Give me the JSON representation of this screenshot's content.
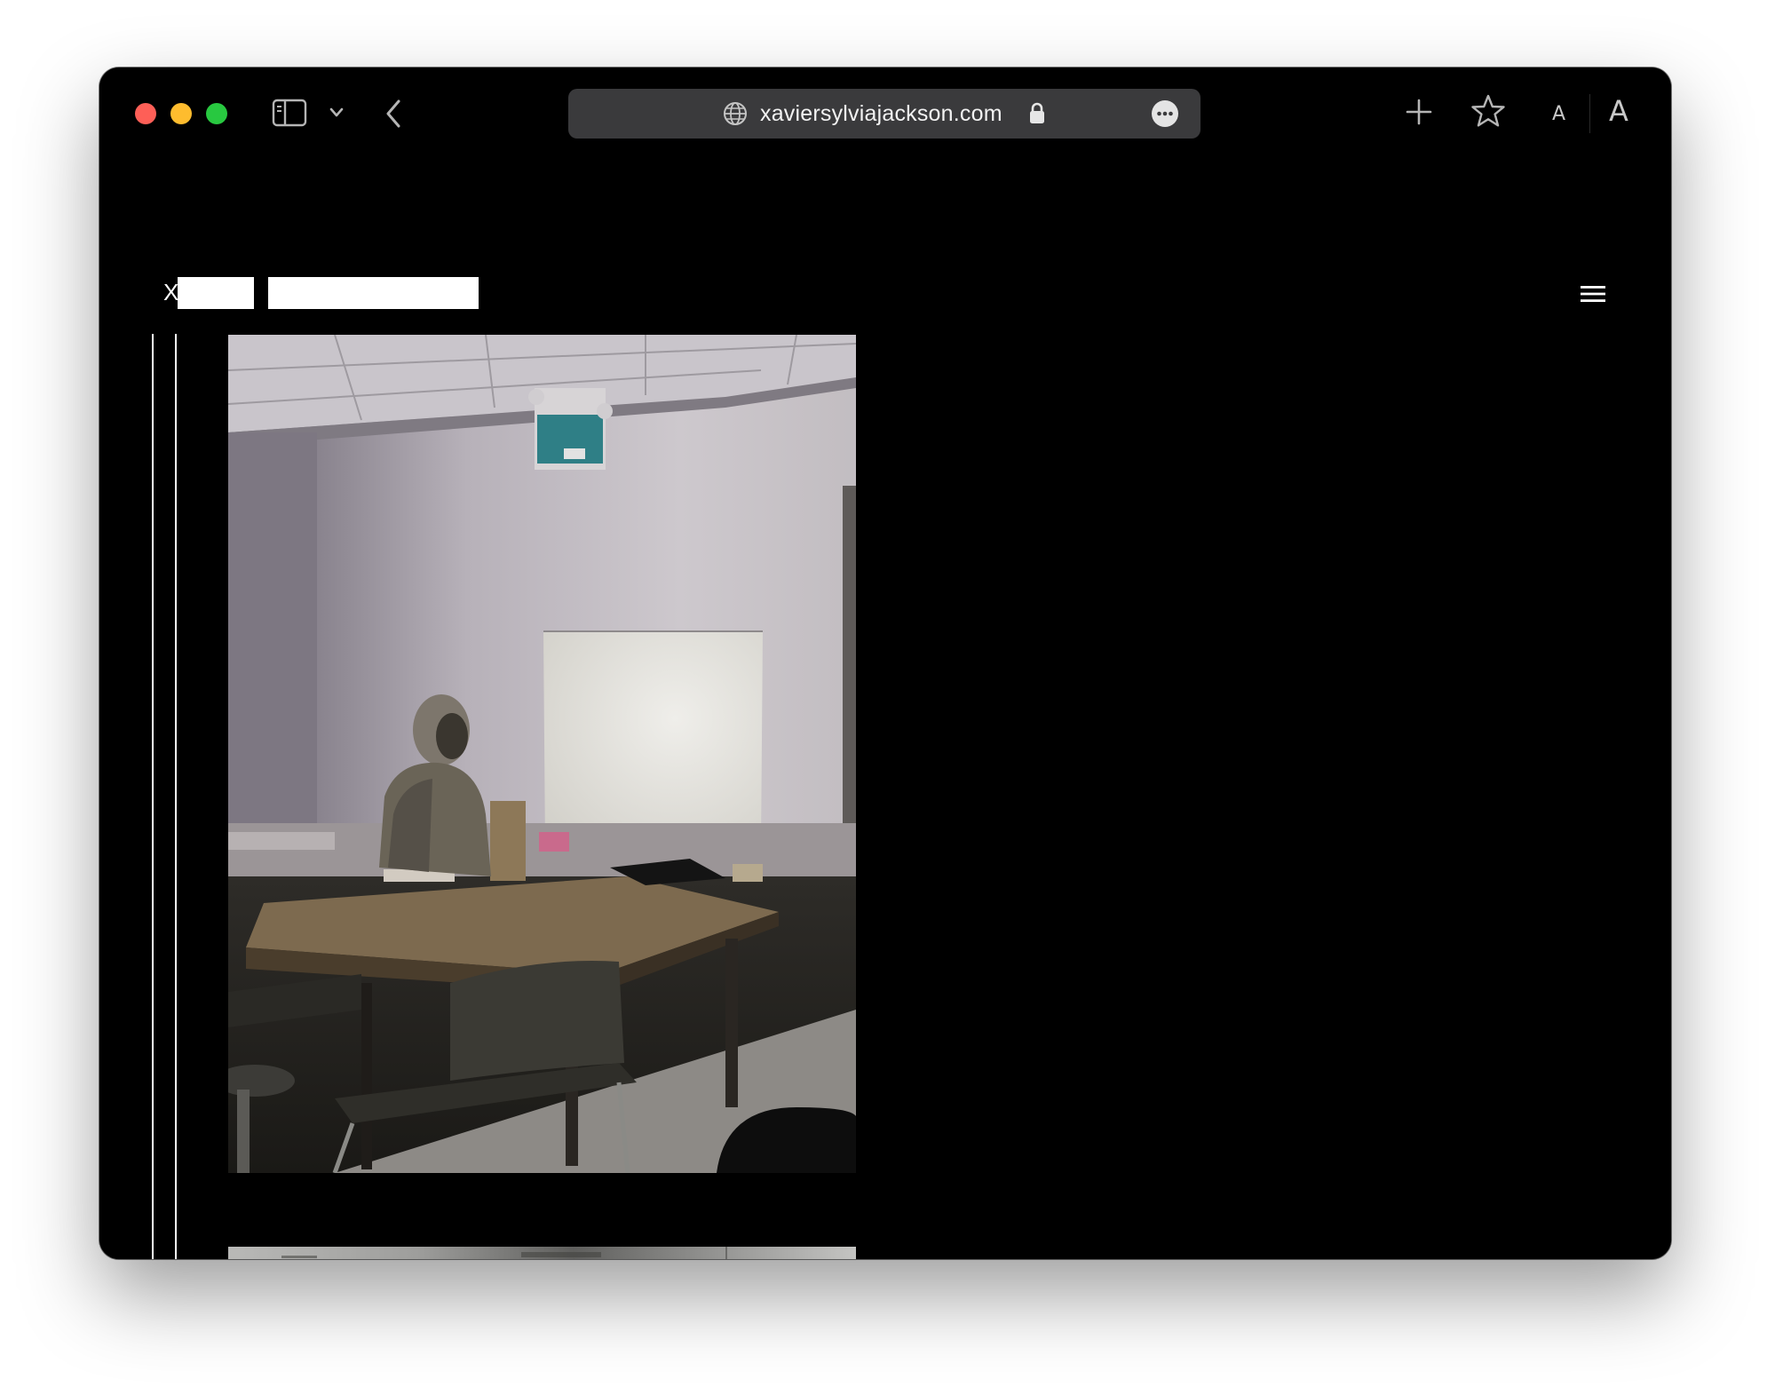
{
  "browser": {
    "url": "xaviersylviajackson.com",
    "font_size_small": "A",
    "font_size_large": "A"
  },
  "site": {
    "title_initial": "X"
  },
  "colors": {
    "background": "#000000",
    "address_bar": "#3a3a3c",
    "traffic_red": "#fe5f57",
    "traffic_yellow": "#febc2e",
    "traffic_green": "#28c840"
  },
  "icons": [
    "sidebar-icon",
    "chevron-down-icon",
    "back-arrow-icon",
    "globe-icon",
    "lock-icon",
    "more-icon",
    "plus-icon",
    "star-icon",
    "hamburger-menu-icon"
  ]
}
